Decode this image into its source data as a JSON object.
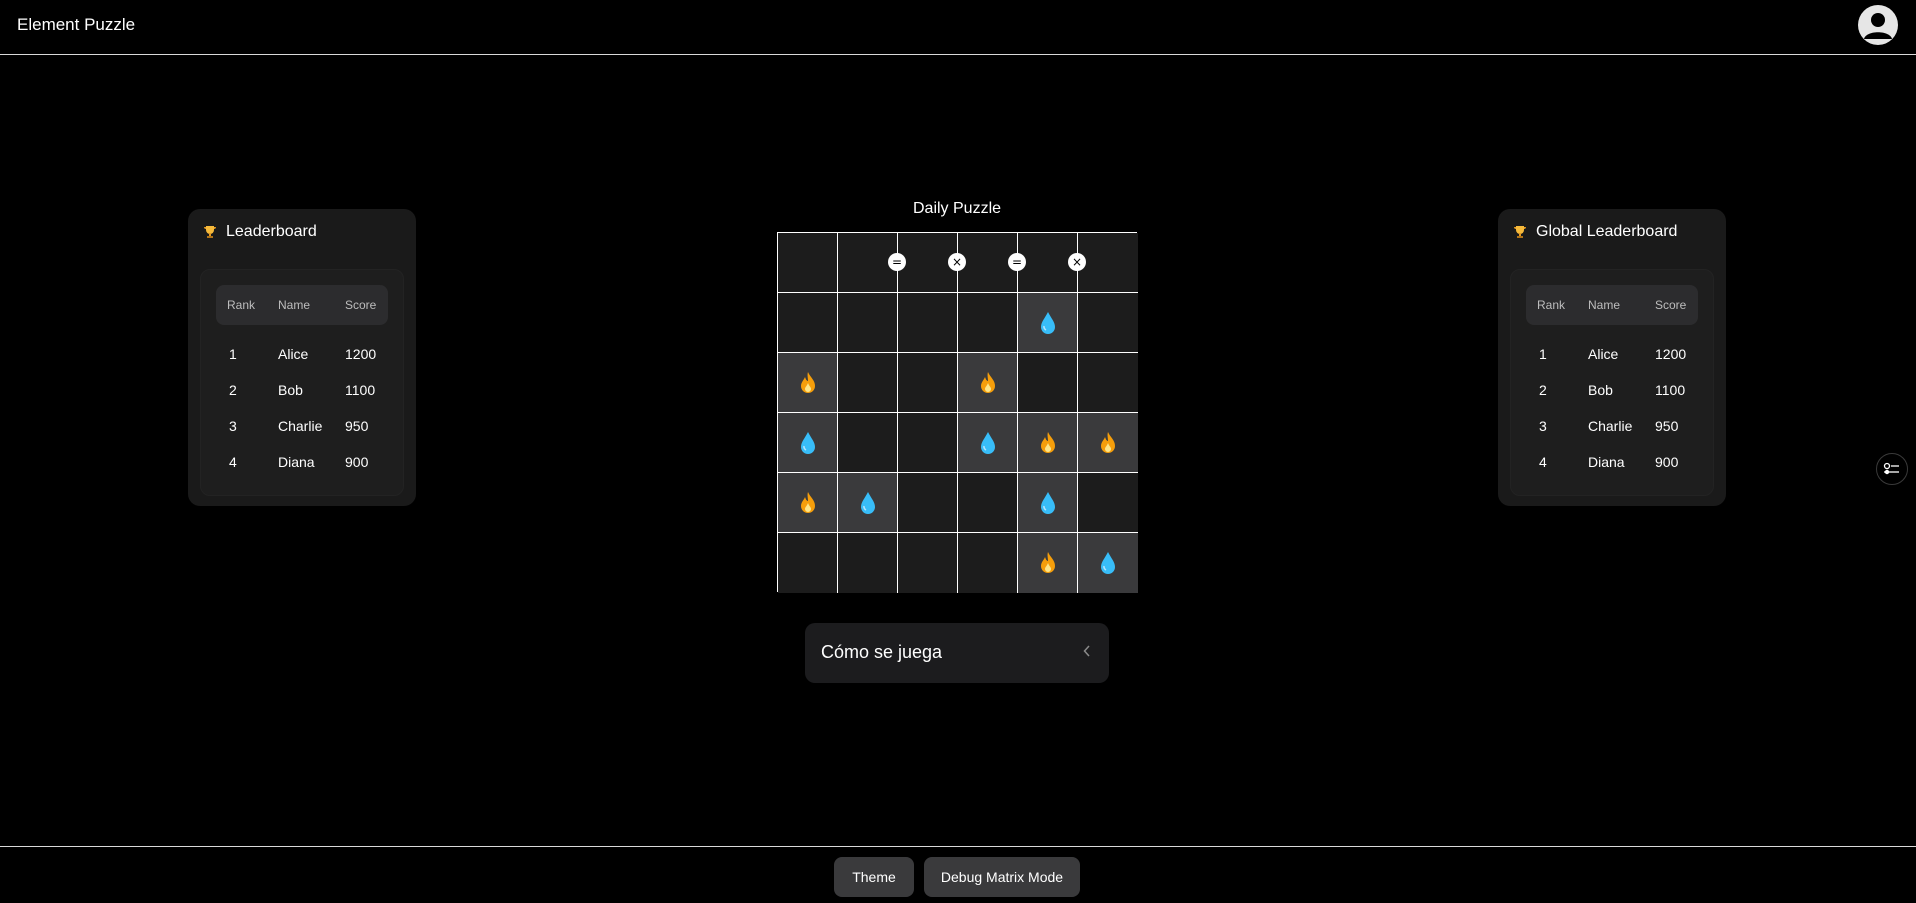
{
  "header": {
    "title": "Element Puzzle",
    "avatar_icon": "user-avatar-icon"
  },
  "leaderboard": {
    "title": "Leaderboard",
    "icon": "trophy-icon",
    "columns": [
      "Rank",
      "Name",
      "Score"
    ],
    "rows": [
      {
        "rank": "1",
        "name": "Alice",
        "score": "1200"
      },
      {
        "rank": "2",
        "name": "Bob",
        "score": "1100"
      },
      {
        "rank": "3",
        "name": "Charlie",
        "score": "950"
      },
      {
        "rank": "4",
        "name": "Diana",
        "score": "900"
      }
    ]
  },
  "global_leaderboard": {
    "title": "Global Leaderboard",
    "icon": "trophy-icon",
    "columns": [
      "Rank",
      "Name",
      "Score"
    ],
    "rows": [
      {
        "rank": "1",
        "name": "Alice",
        "score": "1200"
      },
      {
        "rank": "2",
        "name": "Bob",
        "score": "1100"
      },
      {
        "rank": "3",
        "name": "Charlie",
        "score": "950"
      },
      {
        "rank": "4",
        "name": "Diana",
        "score": "900"
      }
    ]
  },
  "puzzle": {
    "title": "Daily Puzzle",
    "rows": 6,
    "cols": 6,
    "cells": [
      [
        "",
        "",
        "",
        "",
        "",
        ""
      ],
      [
        "",
        "",
        "",
        "",
        "water",
        ""
      ],
      [
        "fire",
        "",
        "",
        "fire",
        "",
        ""
      ],
      [
        "water",
        "",
        "",
        "water",
        "fire",
        "fire"
      ],
      [
        "fire",
        "water",
        "",
        "",
        "water",
        ""
      ],
      [
        "",
        "",
        "",
        "",
        "fire",
        "water"
      ]
    ],
    "constraints": [
      {
        "row": 0,
        "between_cols": [
          1,
          2
        ],
        "symbol": "="
      },
      {
        "row": 0,
        "between_cols": [
          2,
          3
        ],
        "symbol": "×"
      },
      {
        "row": 0,
        "between_cols": [
          3,
          4
        ],
        "symbol": "="
      },
      {
        "row": 0,
        "between_cols": [
          4,
          5
        ],
        "symbol": "×"
      }
    ],
    "colors": {
      "fire": "#f59e0b",
      "water": "#38bdf8",
      "filled_cell": "#3a3a3c",
      "empty_cell": "#1c1c1c"
    }
  },
  "how_to_play": {
    "label": "Cómo se juega",
    "chevron_icon": "chevron-left-icon"
  },
  "side_button": {
    "icon": "settings-list-icon"
  },
  "footer": {
    "theme_label": "Theme",
    "debug_label": "Debug Matrix Mode"
  }
}
